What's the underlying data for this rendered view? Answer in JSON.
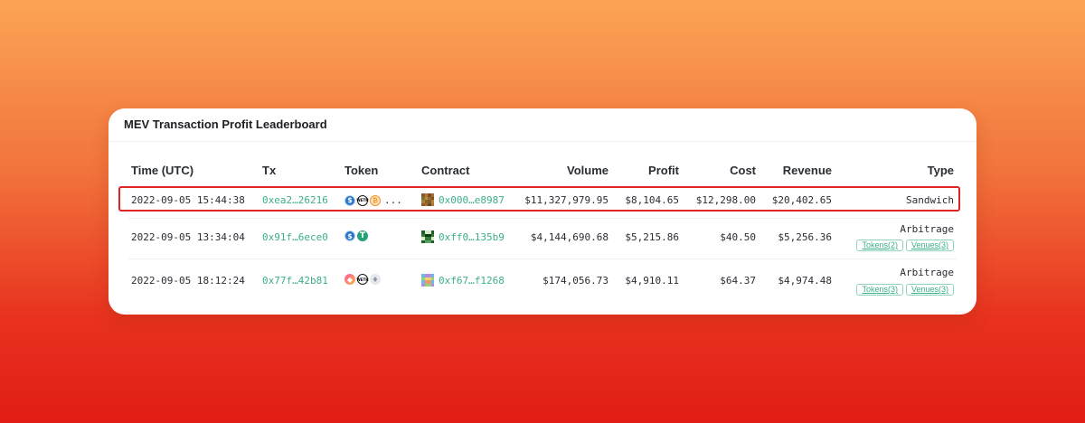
{
  "title": "MEV Transaction Profit Leaderboard",
  "columns": {
    "time": "Time (UTC)",
    "tx": "Tx",
    "token": "Token",
    "contract": "Contract",
    "volume": "Volume",
    "profit": "Profit",
    "cost": "Cost",
    "revenue": "Revenue",
    "type": "Type"
  },
  "rows": [
    {
      "time": "2022-09-05 15:44:38",
      "tx": "0xea2…26216",
      "tokens": [
        "usdc-icon",
        "weth-icon",
        "btc-icon"
      ],
      "tokens_more": "...",
      "contract": "0x000…e8987",
      "volume": "$11,327,979.95",
      "profit": "$8,104.65",
      "cost": "$12,298.00",
      "revenue": "$20,402.65",
      "type": "Sandwich",
      "highlighted": true
    },
    {
      "time": "2022-09-05 13:34:04",
      "tx": "0x91f…6ece0",
      "tokens": [
        "usdc-icon",
        "usdt-icon"
      ],
      "contract": "0xff0…135b9",
      "volume": "$4,144,690.68",
      "profit": "$5,215.86",
      "cost": "$40.50",
      "revenue": "$5,256.36",
      "type": "Arbitrage",
      "tags": [
        "Tokens(2)",
        "Venues(3)"
      ]
    },
    {
      "time": "2022-09-05 18:12:24",
      "tx": "0x77f…42b81",
      "tokens": [
        "multicolor-token-icon",
        "weth-icon",
        "eth-icon"
      ],
      "contract": "0xf67…f1268",
      "volume": "$174,056.73",
      "profit": "$4,910.11",
      "cost": "$64.37",
      "revenue": "$4,974.48",
      "type": "Arbitrage",
      "tags": [
        "Tokens(3)",
        "Venues(3)"
      ]
    }
  ],
  "colors": {
    "link": "#3cae8c",
    "highlight_border": "#df2424",
    "background_top": "#fba456",
    "background_bottom": "#e11c14"
  }
}
